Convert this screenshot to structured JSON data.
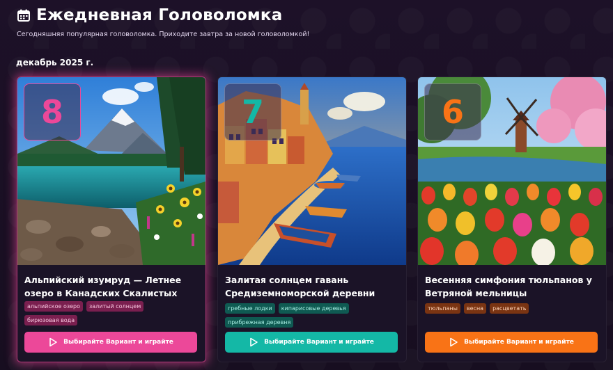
{
  "header": {
    "title": "Ежедневная Головоломка",
    "subtitle": "Сегодняшняя популярная головоломка. Приходите завтра за новой головоломкой!"
  },
  "month": "декабрь 2025 г.",
  "cards": [
    {
      "rank": "8",
      "title": "Альпийский изумруд — Летнее озеро в Канадских Скалистых горах",
      "tags": [
        "альпийское озеро",
        "залитый солнцем",
        "бирюзовая вода"
      ],
      "button_label": "Выбирайте Вариант и играйте",
      "accent": "#ec4899"
    },
    {
      "rank": "7",
      "title": "Залитая солнцем гавань Средиземноморской деревни",
      "tags": [
        "гребные лодки",
        "кипарисовые деревья",
        "прибрежная деревня"
      ],
      "button_label": "Выбирайте Вариант и играйте",
      "accent": "#14b8a6"
    },
    {
      "rank": "6",
      "title": "Весенняя симфония тюльпанов у Ветряной мельницы",
      "tags": [
        "тюльпаны",
        "весна",
        "расцветать"
      ],
      "button_label": "Выбирайте Вариант и играйте",
      "accent": "#f97316"
    }
  ]
}
